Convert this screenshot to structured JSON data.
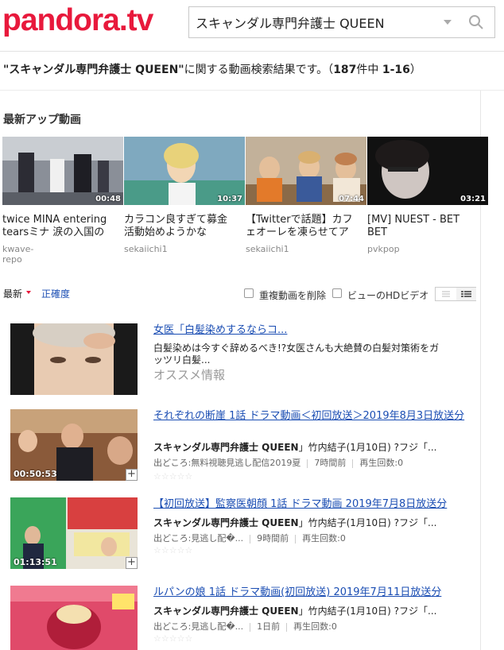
{
  "header": {
    "logo": "pandora.tv",
    "search_value": "スキャンダル専門弁護士 QUEEN"
  },
  "results": {
    "query_quoted": "\"スキャンダル専門弁護士 QUEEN\"",
    "suffix": "に関する動画検索結果です。（",
    "total": "187",
    "mid": "件中 ",
    "range": "1-16",
    "close": "）"
  },
  "latest": {
    "title": "最新アップ動画",
    "items": [
      {
        "duration": "00:48",
        "title": "twice MINA entering tearsミナ 涙の入国の",
        "user": "kwave-repo"
      },
      {
        "duration": "10:37",
        "title": "カラコン良すぎて募金活動始めようかな",
        "user": "sekaiichi1"
      },
      {
        "duration": "07:44",
        "title": "【Twitterで話題】カフェオーレを凍らせてア",
        "user": "sekaiichi1"
      },
      {
        "duration": "03:21",
        "title": "[MV] NUEST - BET BET",
        "user": "pvkpop"
      }
    ]
  },
  "sort": {
    "latest": "最新",
    "accuracy": "正確度",
    "dedupe": "重複動画を削除",
    "hd": "ビューのHDビデオ"
  },
  "ad": {
    "title": "女医「白髪染めするならコ...",
    "text": "白髪染めは今すぐ辞めるべき!?女医さんも大絶賛の白髪対策術をガッツリ白髪...",
    "label": "オススメ情報"
  },
  "videos": [
    {
      "title": "それぞれの断崖 1話 ドラマ動画＜初回放送＞2019年8月3日放送分",
      "desc_bold": "スキャンダル専門弁護士 QUEEN",
      "desc_rest": "」竹内結子(1月10日) ?フジ「...",
      "source": "出どころ:無料視聴見逃し配信2019夏",
      "time": "7時間前",
      "views": "再生回数:0",
      "duration": "00:50:53"
    },
    {
      "title": "【初回放送】監察医朝顔 1話 ドラマ動画 2019年7月8日放送分",
      "desc_bold": "スキャンダル専門弁護士 QUEEN",
      "desc_rest": "」竹内結子(1月10日) ?フジ「...",
      "source": "出どころ:見逃し配�...",
      "time": "9時間前",
      "views": "再生回数:0",
      "duration": "01:13:51"
    },
    {
      "title": "ルパンの娘 1話 ドラマ動画(初回放送) 2019年7月11日放送分",
      "desc_bold": "スキャンダル専門弁護士 QUEEN",
      "desc_rest": "」竹内結子(1月10日) ?フジ「...",
      "source": "出どころ:見逃し配�...",
      "time": "1日前",
      "views": "再生回数:0",
      "duration": ""
    }
  ],
  "stars": "☆☆☆☆☆"
}
